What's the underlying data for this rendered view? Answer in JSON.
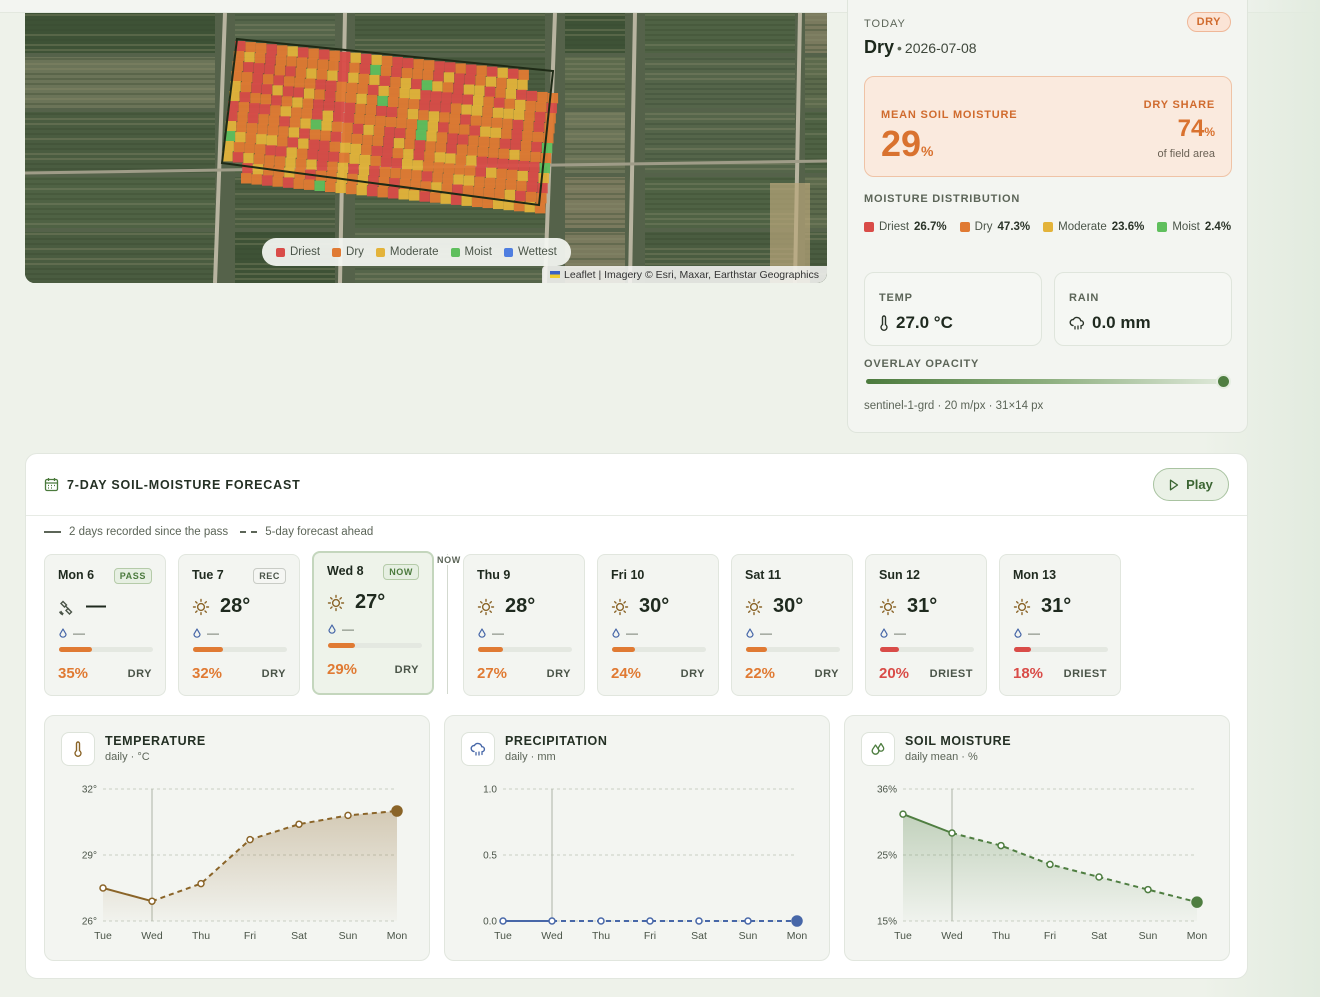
{
  "map": {
    "legend": [
      {
        "label": "Driest",
        "color": "#d94c48"
      },
      {
        "label": "Dry",
        "color": "#e07a33"
      },
      {
        "label": "Moderate",
        "color": "#e3b33a"
      },
      {
        "label": "Moist",
        "color": "#5fbf5d"
      },
      {
        "label": "Wettest",
        "color": "#4f7ee0"
      }
    ],
    "attribution": "Leaflet | Imagery © Esri, Maxar, Earthstar Geographics"
  },
  "today": {
    "label": "TODAY",
    "badge": "DRY",
    "status": "Dry",
    "separator": "•",
    "date": "2026-07-08",
    "mean_label": "MEAN SOIL MOISTURE",
    "mean_value": "29",
    "mean_unit": "%",
    "dry_share_label": "DRY SHARE",
    "dry_share_value": "74",
    "dry_share_unit": "%",
    "dry_share_sub": "of field area",
    "distribution_label": "MOISTURE DISTRIBUTION",
    "distribution": [
      {
        "label": "Driest",
        "pct": "26.7%",
        "color": "#d94c48"
      },
      {
        "label": "Dry",
        "pct": "47.3%",
        "color": "#e07a33"
      },
      {
        "label": "Moderate",
        "pct": "23.6%",
        "color": "#e3b33a"
      },
      {
        "label": "Moist",
        "pct": "2.4%",
        "color": "#5fbf5d"
      }
    ],
    "temp_label": "TEMP",
    "temp_value": "27.0 °C",
    "rain_label": "RAIN",
    "rain_value": "0.0 mm",
    "opacity_label": "OVERLAY OPACITY",
    "opacity": 1.0,
    "source": "sentinel-1-grd · 20 m/px · 31×14 px"
  },
  "forecast": {
    "title": "7-DAY SOIL-MOISTURE FORECAST",
    "play_label": "Play",
    "legend_recorded": "2 days recorded since the pass",
    "legend_forecast": "5-day forecast ahead",
    "now_label": "NOW",
    "days": [
      {
        "name": "Mon 6",
        "tag": "PASS",
        "icon": "satellite-icon",
        "temp": "—",
        "rain": "—",
        "moisture": "35%",
        "moisture_value": 35,
        "class": "DRY",
        "color": "#e07a33"
      },
      {
        "name": "Tue 7",
        "tag": "REC",
        "icon": "sun-icon",
        "temp": "28°",
        "rain": "—",
        "moisture": "32%",
        "moisture_value": 32,
        "class": "DRY",
        "color": "#e07a33"
      },
      {
        "name": "Wed 8",
        "tag": "NOW",
        "icon": "sun-icon",
        "temp": "27°",
        "rain": "—",
        "moisture": "29%",
        "moisture_value": 29,
        "class": "DRY",
        "color": "#e07a33"
      },
      {
        "name": "Thu 9",
        "tag": "",
        "icon": "sun-icon",
        "temp": "28°",
        "rain": "—",
        "moisture": "27%",
        "moisture_value": 27,
        "class": "DRY",
        "color": "#e07a33"
      },
      {
        "name": "Fri 10",
        "tag": "",
        "icon": "sun-icon",
        "temp": "30°",
        "rain": "—",
        "moisture": "24%",
        "moisture_value": 24,
        "class": "DRY",
        "color": "#e07a33"
      },
      {
        "name": "Sat 11",
        "tag": "",
        "icon": "sun-icon",
        "temp": "30°",
        "rain": "—",
        "moisture": "22%",
        "moisture_value": 22,
        "class": "DRY",
        "color": "#e07a33"
      },
      {
        "name": "Sun 12",
        "tag": "",
        "icon": "sun-icon",
        "temp": "31°",
        "rain": "—",
        "moisture": "20%",
        "moisture_value": 20,
        "class": "DRIEST",
        "color": "#d94c48"
      },
      {
        "name": "Mon 13",
        "tag": "",
        "icon": "sun-icon",
        "temp": "31°",
        "rain": "—",
        "moisture": "18%",
        "moisture_value": 18,
        "class": "DRIEST",
        "color": "#d94c48"
      }
    ]
  },
  "charts": {
    "temperature": {
      "title": "TEMPERATURE",
      "subtitle": "daily · °C"
    },
    "precipitation": {
      "title": "PRECIPITATION",
      "subtitle": "daily · mm"
    },
    "soil": {
      "title": "SOIL MOISTURE",
      "subtitle": "daily mean · %"
    }
  },
  "chart_data": [
    {
      "type": "line",
      "title": "TEMPERATURE",
      "subtitle": "daily · °C",
      "x": [
        "Tue",
        "Wed",
        "Thu",
        "Fri",
        "Sat",
        "Sun",
        "Mon"
      ],
      "values": [
        27.5,
        26.9,
        27.7,
        29.7,
        30.4,
        30.8,
        31.0
      ],
      "y_ticks": [
        "26°",
        "29°",
        "32°"
      ],
      "ylim": [
        26,
        32
      ],
      "recorded_until_index": 1,
      "color": "#8a6428",
      "fill": true,
      "grid": true
    },
    {
      "type": "line",
      "title": "PRECIPITATION",
      "subtitle": "daily · mm",
      "x": [
        "Tue",
        "Wed",
        "Thu",
        "Fri",
        "Sat",
        "Sun",
        "Mon"
      ],
      "values": [
        0,
        0,
        0,
        0,
        0,
        0,
        0
      ],
      "y_ticks": [
        "0.0",
        "0.5",
        "1.0"
      ],
      "ylim": [
        0,
        1
      ],
      "recorded_until_index": 1,
      "color": "#4767a8",
      "fill": false,
      "grid": true
    },
    {
      "type": "area",
      "title": "SOIL MOISTURE",
      "subtitle": "daily mean · %",
      "x": [
        "Tue",
        "Wed",
        "Thu",
        "Fri",
        "Sat",
        "Sun",
        "Mon"
      ],
      "values": [
        32,
        29,
        27,
        24,
        22,
        20,
        18
      ],
      "y_ticks": [
        "15%",
        "25%",
        "36%"
      ],
      "ylim": [
        15,
        36
      ],
      "recorded_until_index": 1,
      "color": "#4f7e41",
      "fill": true,
      "grid": true
    }
  ]
}
